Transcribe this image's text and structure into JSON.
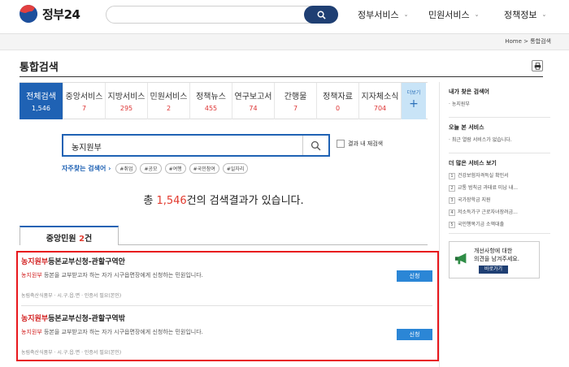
{
  "header": {
    "logo_text": "정부24",
    "search_value": "",
    "nav": [
      "정부서비스",
      "민원서비스",
      "정책정보"
    ]
  },
  "breadcrumb": {
    "home": "Home",
    "sep": ">",
    "current": "통합검색"
  },
  "page_title": "통합검색",
  "tabs": [
    {
      "label": "전체검색",
      "count": "1,546",
      "active": true
    },
    {
      "label": "중앙서비스",
      "count": "7"
    },
    {
      "label": "지방서비스",
      "count": "295"
    },
    {
      "label": "민원서비스",
      "count": "2"
    },
    {
      "label": "정책뉴스",
      "count": "455"
    },
    {
      "label": "연구보고서",
      "count": "74"
    },
    {
      "label": "간행물",
      "count": "7"
    },
    {
      "label": "정책자료",
      "count": "0"
    },
    {
      "label": "지자체소식",
      "count": "704"
    }
  ],
  "more_tab": {
    "label": "더보기",
    "plus": "+"
  },
  "search": {
    "value": "농지원부",
    "recheck_label": "결과 내 재검색"
  },
  "frequent": {
    "label": "자주찾는 검색어",
    "arrow": "›",
    "chips": [
      "#취업",
      "#공모",
      "#여행",
      "#국민참여",
      "#일자리"
    ]
  },
  "summary": {
    "prefix": "총 ",
    "count": "1,546",
    "suffix": "건의 검색결과가 있습니다."
  },
  "section_tab": {
    "label": "중앙민원 ",
    "count": "2",
    "unit": "건"
  },
  "results": [
    {
      "title_hl": "농지원부",
      "title_rest": "등본교부신청-관할구역안",
      "desc_hl": "농지원부",
      "desc_rest": " 등본을 교부받고자 하는 자가 시구읍면장에게 신청하는 민원입니다.",
      "meta": "농림축산식품부  ·  시.구.읍.면  ·  인증서 필요(본인)",
      "button": "신청"
    },
    {
      "title_hl": "농지원부",
      "title_rest": "등본교부신청-관할구역밖",
      "desc_hl": "농지원부",
      "desc_rest": " 등본을 교부받고자 하는 자가 시구읍면장에게 신청하는 민원입니다.",
      "meta": "농림축산식품부  ·  시.구.읍.면  ·  인증서 필요(본인)",
      "button": "신청"
    }
  ],
  "sidebar": {
    "recent_search": {
      "title": "내가 찾은 검색어",
      "items": [
        "· 농지원부"
      ]
    },
    "today_service": {
      "title": "오늘 본 서비스",
      "items": [
        "· 최근 열람 서비스가 없습니다."
      ]
    },
    "popular": {
      "title": "더 많은 서비스 보기",
      "items": [
        {
          "rank": "1",
          "text": "건강보험자격득실 확인서"
        },
        {
          "rank": "2",
          "text": "교통 범칙금 과태료 미납 내..."
        },
        {
          "rank": "3",
          "text": "국가장학금 지원"
        },
        {
          "rank": "4",
          "text": "저소득가구 근로자녀장려금..."
        },
        {
          "rank": "5",
          "text": "국민행복기금 소액대출"
        }
      ]
    },
    "feedback": {
      "line1": "개선사항에 대한",
      "line2": "의견을 남겨주세요.",
      "button": "바로가기"
    }
  },
  "colors": {
    "primary": "#1f62b4",
    "highlight": "#e8161c",
    "accent": "#2b86d6"
  },
  "icons": {
    "search": "search-icon",
    "print": "print-icon",
    "megaphone": "megaphone-icon"
  }
}
